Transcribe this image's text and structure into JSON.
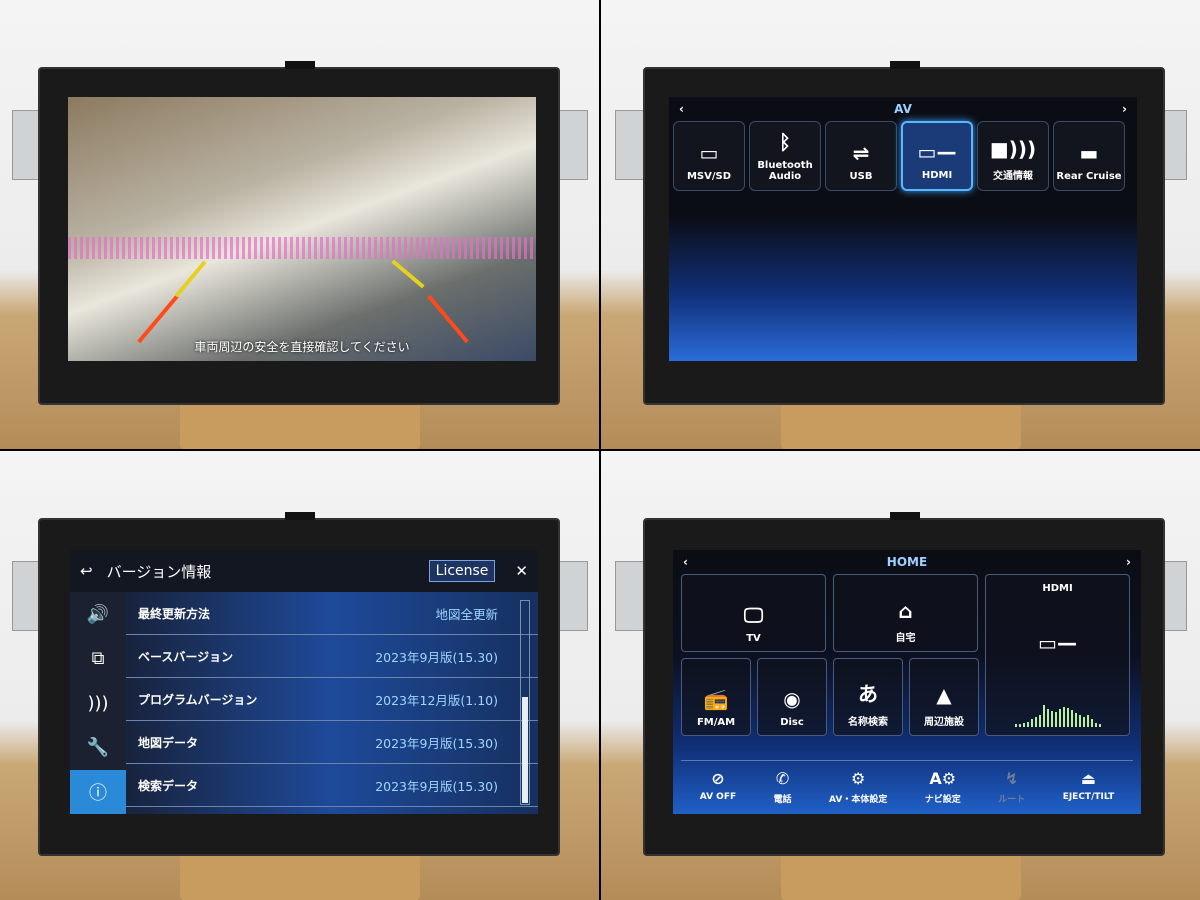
{
  "camera": {
    "caption": "車両周辺の安全を直接確認してください"
  },
  "av": {
    "title": "AV",
    "prev": "‹",
    "next": "›",
    "tiles": [
      {
        "label": "MSV/SD",
        "icon": "sd-card-icon",
        "glyph": "▭"
      },
      {
        "label": "Bluetooth Audio",
        "icon": "bluetooth-icon",
        "glyph": "ᛒ"
      },
      {
        "label": "USB",
        "icon": "usb-icon",
        "glyph": "⇌"
      },
      {
        "label": "HDMI",
        "icon": "hdmi-icon",
        "glyph": "▭—",
        "selected": true
      },
      {
        "label": "交通情報",
        "icon": "signal-icon",
        "glyph": "■)))"
      },
      {
        "label": "Rear Cruise",
        "icon": "rear-monitor-icon",
        "glyph": "▬"
      }
    ]
  },
  "version": {
    "title": "バージョン情報",
    "license": "License",
    "back": "↩",
    "close": "✕",
    "side": [
      {
        "icon": "speaker-icon",
        "glyph": "🔊"
      },
      {
        "icon": "devices-icon",
        "glyph": "⧉"
      },
      {
        "icon": "wireless-icon",
        "glyph": ")))"
      },
      {
        "icon": "tools-icon",
        "glyph": "🔧"
      },
      {
        "icon": "info-icon",
        "glyph": "ⓘ",
        "active": true
      }
    ],
    "rows": [
      {
        "label": "最終更新方法",
        "value": "地図全更新"
      },
      {
        "label": "ベースバージョン",
        "value": "2023年9月版(15.30)"
      },
      {
        "label": "プログラムバージョン",
        "value": "2023年12月版(1.10)"
      },
      {
        "label": "地図データ",
        "value": "2023年9月版(15.30)"
      },
      {
        "label": "検索データ",
        "value": "2023年9月版(15.30)"
      }
    ],
    "scroll_position": 0.52
  },
  "home": {
    "title": "HOME",
    "prev": "‹",
    "next": "›",
    "tiles": {
      "tv": "TV",
      "home": "自宅",
      "hdmi": "HDMI",
      "fmam": "FM/AM",
      "disc": "Disc",
      "name_search": "名称検索",
      "nearby": "周辺施設"
    },
    "bottom": [
      {
        "label": "AV OFF",
        "icon": "av-off-icon",
        "glyph": "⊘"
      },
      {
        "label": "電話",
        "icon": "phone-icon",
        "glyph": "✆"
      },
      {
        "label": "AV・本体設定",
        "icon": "gear-icon",
        "glyph": "⚙"
      },
      {
        "label": "ナビ設定",
        "icon": "nav-settings-icon",
        "glyph": "A⚙"
      },
      {
        "label": "ルート",
        "icon": "route-icon",
        "glyph": "↯",
        "disabled": true
      },
      {
        "label": "EJECT/TILT",
        "icon": "eject-tilt-icon",
        "glyph": "⏏"
      }
    ]
  }
}
